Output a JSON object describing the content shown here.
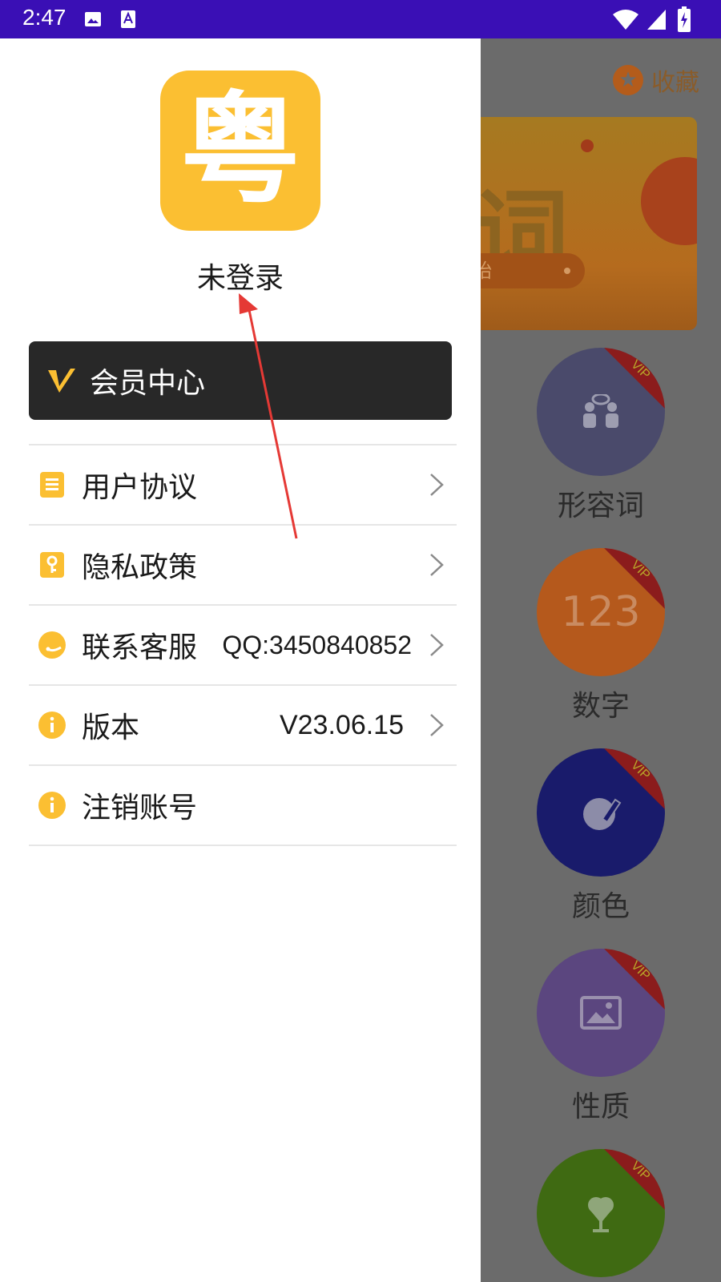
{
  "status_bar": {
    "time": "2:47"
  },
  "background": {
    "favorites_label": "收藏",
    "banner_big_text": "词",
    "banner_button_text": "始",
    "categories": [
      {
        "name": "形容词",
        "badge": "VIP",
        "color": "#4a4a6b",
        "icon": "people-talking-icon"
      },
      {
        "name": "数字",
        "badge": "VIP",
        "color": "#b5591c",
        "icon": "numbers-icon",
        "glyph": "123"
      },
      {
        "name": "颜色",
        "badge": "VIP",
        "color": "#191b6b",
        "icon": "palette-pencil-icon"
      },
      {
        "name": "性质",
        "badge": "VIP",
        "color": "#5b467f",
        "icon": "picture-icon"
      },
      {
        "name": "",
        "badge": "VIP",
        "color": "#3f6a12",
        "icon": "ice-cream-icon"
      }
    ]
  },
  "drawer": {
    "logo_char": "粤",
    "login_status": "未登录",
    "vip": {
      "label": "会员中心",
      "icon": "v-logo-icon"
    },
    "menu": [
      {
        "label": "用户协议",
        "value": "",
        "icon": "document-icon",
        "chevron": true
      },
      {
        "label": "隐私政策",
        "value": "",
        "icon": "key-icon",
        "chevron": true
      },
      {
        "label": "联系客服",
        "value": "QQ:3450840852",
        "icon": "customer-service-icon",
        "chevron": true
      },
      {
        "label": "版本",
        "value": "V23.06.15",
        "icon": "info-icon",
        "chevron": true
      },
      {
        "label": "注销账号",
        "value": "",
        "icon": "info-icon",
        "chevron": false
      }
    ]
  },
  "colors": {
    "accent": "#fbbf32",
    "status_bar": "#3a0fb5",
    "vip_bar": "#282828",
    "annotation": "#e53935"
  }
}
